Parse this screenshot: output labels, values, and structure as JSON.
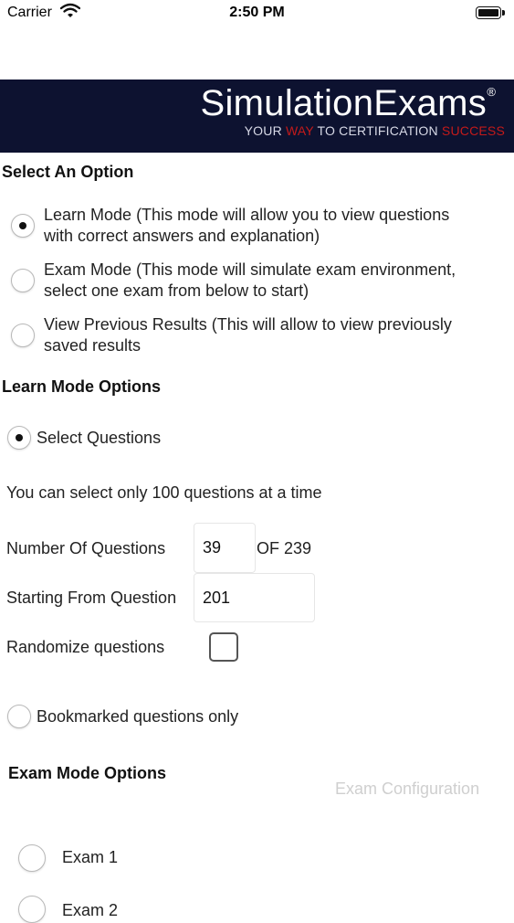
{
  "status_bar": {
    "carrier": "Carrier",
    "time": "2:50 PM"
  },
  "banner": {
    "brand": "SimulationExams",
    "registered": "®",
    "tagline": {
      "part1": "YOUR ",
      "way": "WAY",
      "part2": " TO CERTIFICATION ",
      "success": "SUCCESS"
    }
  },
  "select_option": {
    "heading": "Select An Option",
    "options": [
      {
        "line1": "Learn Mode (This mode will allow you to view questions",
        "line2": "with correct answers and explanation)",
        "selected": true
      },
      {
        "line1": "Exam Mode (This mode will simulate exam environment,",
        "line2": "select one exam from below to start)",
        "selected": false
      },
      {
        "line1": "View Previous Results (This will allow to view previously",
        "line2": "saved results",
        "selected": false
      }
    ]
  },
  "learn_mode": {
    "heading": "Learn Mode Options",
    "select_questions": "Select Questions",
    "limit_note": "You can select only 100 questions at a time",
    "number_label": "Number Of Questions",
    "number_value": "39",
    "number_total": "OF 239",
    "start_label": "Starting From Question",
    "start_value": "201",
    "randomize_label": "Randomize questions",
    "bookmarked_label": "Bookmarked questions only"
  },
  "exam_mode": {
    "heading": "Exam Mode Options",
    "config_link": "Exam Configuration",
    "exams": [
      "Exam 1",
      "Exam 2"
    ]
  }
}
